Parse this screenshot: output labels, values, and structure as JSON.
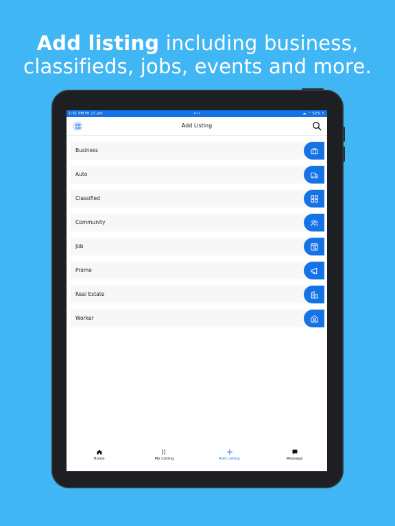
{
  "headline": {
    "bold": "Add listing",
    "rest_line1": "including business,",
    "line2": "classifieds, jobs, events and more."
  },
  "status_bar": {
    "time": "1:31 PM   Fri 27 Jun",
    "center": "•••",
    "right": "☁ ⌔ 32% ⚡"
  },
  "app_bar": {
    "title": "Add Listing",
    "menu_icon": "grid-icon",
    "search_icon": "search-icon"
  },
  "categories": [
    {
      "label": "Business",
      "icon": "briefcase-icon"
    },
    {
      "label": "Auto",
      "icon": "truck-icon"
    },
    {
      "label": "Classified",
      "icon": "grid-icon"
    },
    {
      "label": "Community",
      "icon": "users-icon"
    },
    {
      "label": "Job",
      "icon": "job-search-icon"
    },
    {
      "label": "Promo",
      "icon": "megaphone-icon"
    },
    {
      "label": "Real Estate",
      "icon": "building-icon"
    },
    {
      "label": "Worker",
      "icon": "worker-icon"
    }
  ],
  "tabs": [
    {
      "label": "Home",
      "icon": "home-icon",
      "active": false
    },
    {
      "label": "My Listing",
      "icon": "list-icon",
      "active": false
    },
    {
      "label": "Add Listing",
      "icon": "plus-icon",
      "active": true
    },
    {
      "label": "Message",
      "icon": "message-icon",
      "active": false
    }
  ],
  "colors": {
    "background": "#41b6f4",
    "accent": "#1573e6",
    "device": "#1d1f22"
  }
}
